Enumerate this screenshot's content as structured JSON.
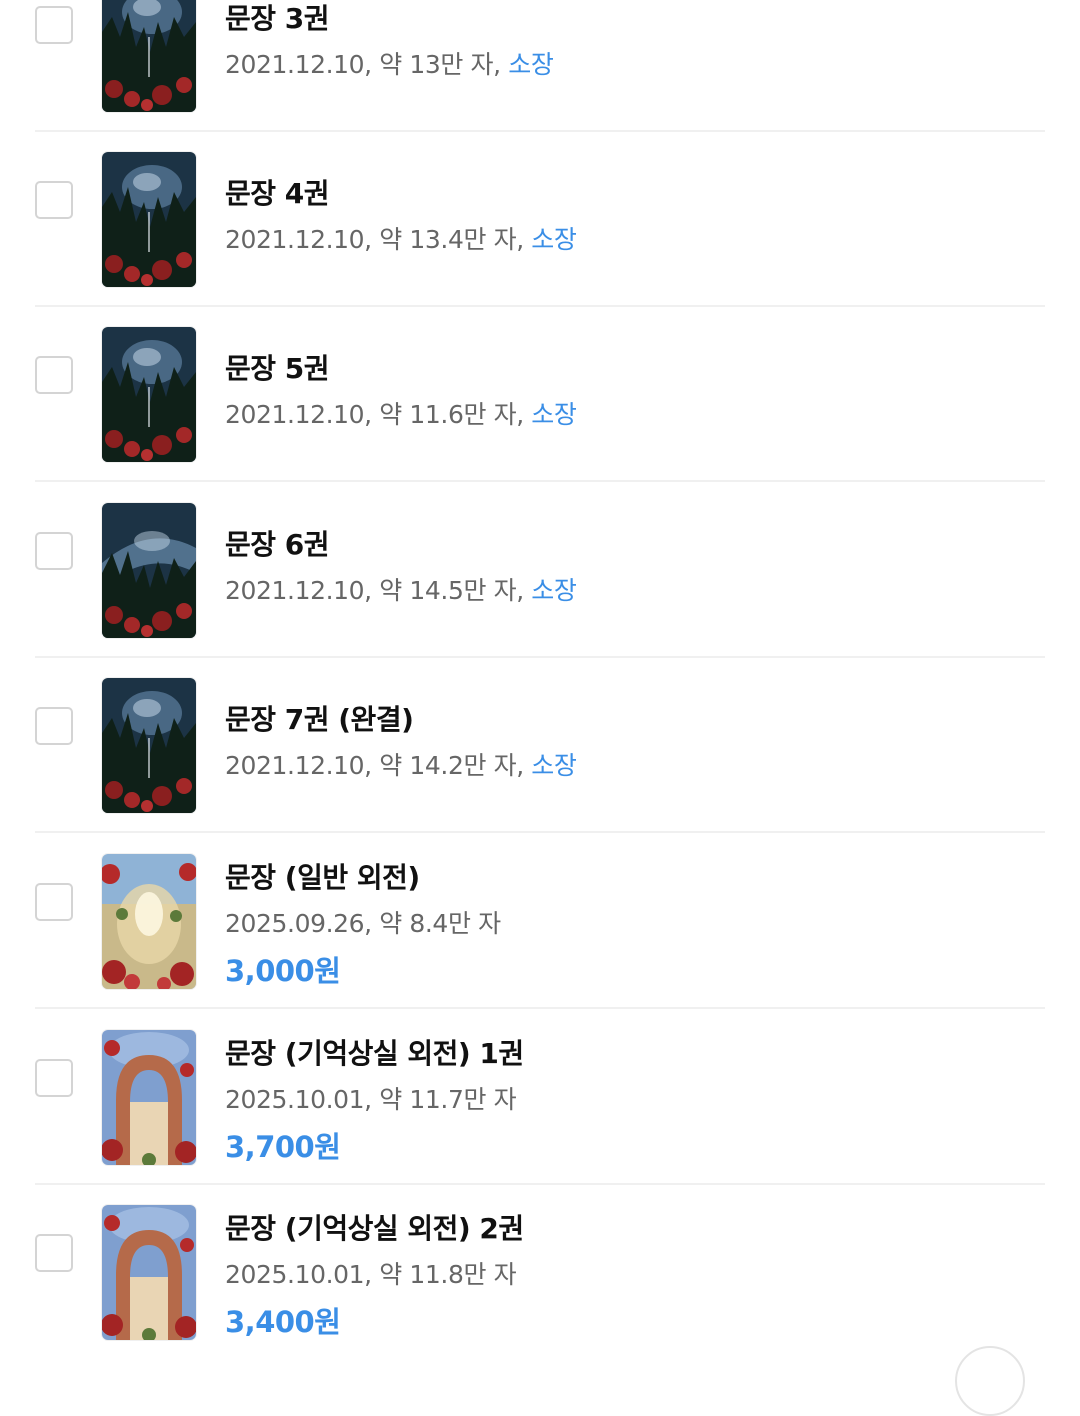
{
  "books": [
    {
      "title": "문장 3권",
      "date": "2021.12.10",
      "size": "약 13만 자",
      "status": "소장",
      "cover": "night"
    },
    {
      "title": "문장 4권",
      "date": "2021.12.10",
      "size": "약 13.4만 자",
      "status": "소장",
      "cover": "night"
    },
    {
      "title": "문장 5권",
      "date": "2021.12.10",
      "size": "약 11.6만 자",
      "status": "소장",
      "cover": "night"
    },
    {
      "title": "문장 6권",
      "date": "2021.12.10",
      "size": "약 14.5만 자",
      "status": "소장",
      "cover": "night"
    },
    {
      "title": "문장 7권 (완결)",
      "date": "2021.12.10",
      "size": "약 14.2만 자",
      "status": "소장",
      "cover": "night"
    },
    {
      "title": "문장 (일반 외전)",
      "date": "2025.09.26",
      "size": "약 8.4만 자",
      "price": "3,000원",
      "cover": "bright"
    },
    {
      "title": "문장 (기억상실 외전) 1권",
      "date": "2025.10.01",
      "size": "약 11.7만 자",
      "price": "3,700원",
      "cover": "arch"
    },
    {
      "title": "문장 (기억상실 외전) 2권",
      "date": "2025.10.01",
      "size": "약 11.8만 자",
      "price": "3,400원",
      "cover": "arch"
    }
  ],
  "colors": {
    "accent": "#3a8ee6",
    "title": "#111111",
    "meta": "#666666",
    "divider": "#f0f0f0"
  }
}
